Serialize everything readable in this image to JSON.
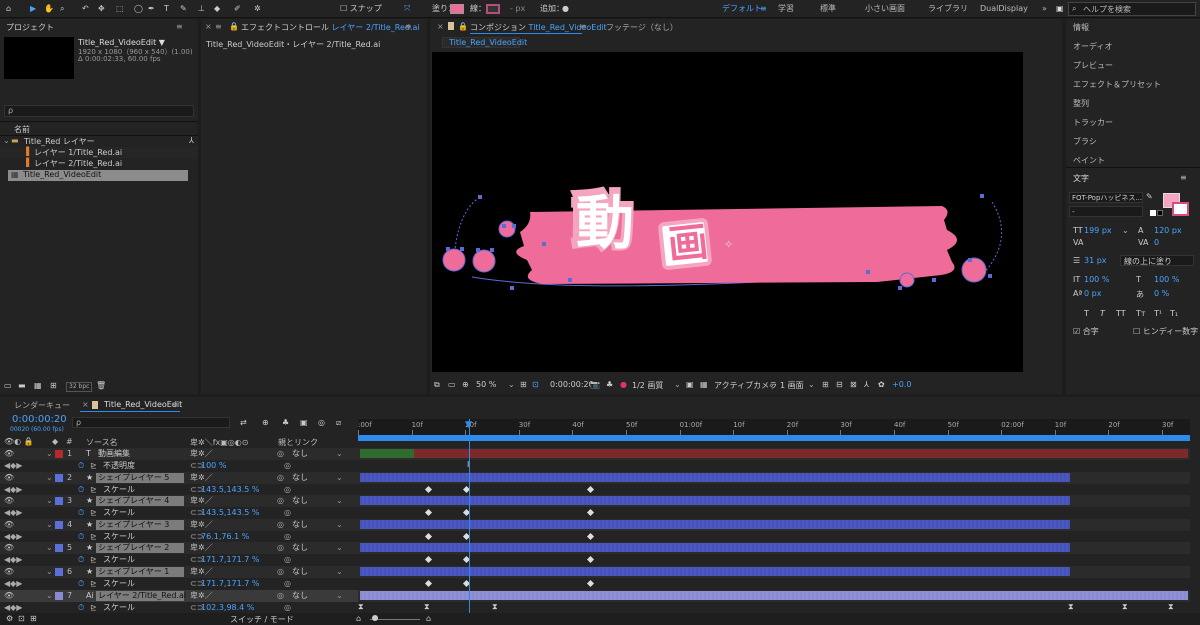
{
  "toolbar": {
    "snap_label": "スナップ",
    "fill_label": "塗り：",
    "stroke_label": "線：",
    "px_label": "- px",
    "add_label": "追加：",
    "workspaces": [
      "デフォルト",
      "学習",
      "標準",
      "小さい画面",
      "ライブラリ",
      "DualDisplay"
    ],
    "search_placeholder": "ヘルプを検索"
  },
  "project": {
    "tab": "プロジェクト",
    "comp_name": "Title_Red_VideoEdit ▼",
    "comp_info1": "1920 x 1080（960 x 540）(1.00)",
    "comp_info2": "Δ 0:00:02:33, 60.00 fps",
    "search_placeholder": "ρ",
    "col_name": "名前",
    "items": [
      "Title_Red レイヤー",
      "レイヤー 1/Title_Red.ai",
      "レイヤー 2/Title_Red.ai",
      "Title_Red_VideoEdit"
    ],
    "bpc": "32 bpc"
  },
  "effect": {
    "tab": "エフェクトコントロール",
    "tab_target": "レイヤー 2/Title_Red.ai",
    "subtitle": "Title_Red_VideoEdit・レイヤー 2/Title_Red.ai"
  },
  "comp": {
    "tab": "コンポジション",
    "tab_target": "Title_Red_VideoEdit",
    "footage_tab": "フッテージ（なし）",
    "breadcrumb": "Title_Red_VideoEdit",
    "title_char1": "動",
    "title_char2": "画",
    "zoom": "50 %",
    "timecode": "0:00:00:20",
    "resolution": "1/2 画質",
    "camera": "アクティブカメラ",
    "views": "1 画面",
    "exposure": "+0.0"
  },
  "right_panel": {
    "items": [
      "情報",
      "オーディオ",
      "プレビュー",
      "エフェクト＆プリセット",
      "整列",
      "トラッカー",
      "ブラシ",
      "ペイント"
    ],
    "char_title": "文字",
    "font": "FOT-Popハッピネス...",
    "font_size": "199 px",
    "leading": "120 px",
    "tracking": "0",
    "stroke_px": "31 px",
    "stroke_mode": "線の上に塗り",
    "vscale": "100 %",
    "hscale": "100 %",
    "baseline": "0 px",
    "tsume": "0 %",
    "style_buttons": [
      "T",
      "T",
      "TT",
      "Tт",
      "T¹",
      "T₁"
    ],
    "faux_bold": "合字",
    "hindi": "ヒンディー数字",
    "fill_color": "#f4a6c0"
  },
  "timeline": {
    "render_tab": "レンダーキュー",
    "comp_tab": "Title_Red_VideoEdit",
    "timecode": "0:00:00:20",
    "fps_info": "00020 (60.00 fps)",
    "col_source": "ソース名",
    "col_parent": "親とリンク",
    "switch_mode": "スイッチ / モード",
    "ruler": [
      ":00f",
      "10f",
      "20f",
      "30f",
      "40f",
      "50f",
      "01:00f",
      "10f",
      "20f",
      "30f",
      "40f",
      "50f",
      "02:00f",
      "10f",
      "20f",
      "30f"
    ],
    "layers": [
      {
        "num": "1",
        "name": "動画編集",
        "type": "T",
        "color": "#b52a2a",
        "prop": "不透明度",
        "prop_val": "100 %",
        "parent": "なし"
      },
      {
        "num": "2",
        "name": "シェイプレイヤー 5",
        "type": "★",
        "color": "#5b6fd6",
        "prop": "スケール",
        "prop_val": "143.5,143.5 %",
        "parent": "なし"
      },
      {
        "num": "3",
        "name": "シェイプレイヤー 4",
        "type": "★",
        "color": "#5b6fd6",
        "prop": "スケール",
        "prop_val": "143.5,143.5 %",
        "parent": "なし"
      },
      {
        "num": "4",
        "name": "シェイプレイヤー 3",
        "type": "★",
        "color": "#5b6fd6",
        "prop": "スケール",
        "prop_val": "76.1,76.1 %",
        "parent": "なし"
      },
      {
        "num": "5",
        "name": "シェイプレイヤー 2",
        "type": "★",
        "color": "#5b6fd6",
        "prop": "スケール",
        "prop_val": "171.7,171.7 %",
        "parent": "なし"
      },
      {
        "num": "6",
        "name": "シェイプレイヤー 1",
        "type": "★",
        "color": "#5b6fd6",
        "prop": "スケール",
        "prop_val": "171.7,171.7 %",
        "parent": "なし"
      },
      {
        "num": "7",
        "name": "レイヤー 2/Title_Red.ai",
        "type": "Ai",
        "color": "#8a8ad0",
        "prop": "スケール",
        "prop_val": "102.3,98.4 %",
        "parent": "なし"
      }
    ]
  },
  "colors": {
    "pink": "#ef6b9a",
    "pink_light": "#f7b3cb",
    "accent": "#2d8ceb",
    "layer_bar": "#4652b8"
  }
}
